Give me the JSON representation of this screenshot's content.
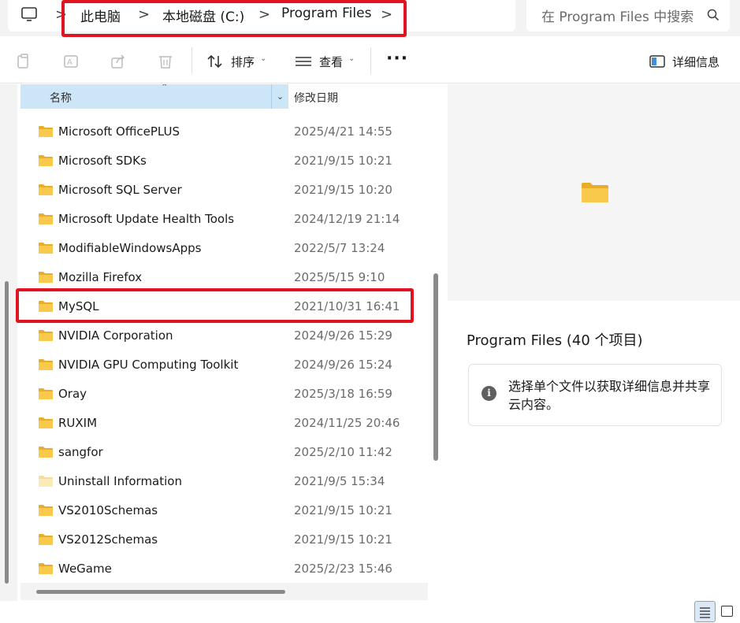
{
  "address_bar": {
    "breadcrumbs": [
      "此电脑",
      "本地磁盘 (C:)",
      "Program Files"
    ],
    "separator": ">",
    "search_placeholder": "在 Program Files 中搜索"
  },
  "toolbar": {
    "sort_label": "排序",
    "view_label": "查看",
    "more_label": "···",
    "details_label": "详细信息"
  },
  "file_list": {
    "columns": {
      "name": "名称",
      "modified": "修改日期"
    },
    "rows": [
      {
        "name": "Microsoft OfficePLUS",
        "modified": "2025/4/21 14:55"
      },
      {
        "name": "Microsoft SDKs",
        "modified": "2021/9/15 10:21"
      },
      {
        "name": "Microsoft SQL Server",
        "modified": "2021/9/15 10:20"
      },
      {
        "name": "Microsoft Update Health Tools",
        "modified": "2024/12/19 21:14"
      },
      {
        "name": "ModifiableWindowsApps",
        "modified": "2022/5/7 13:24"
      },
      {
        "name": "Mozilla Firefox",
        "modified": "2025/5/15 9:10"
      },
      {
        "name": "MySQL",
        "modified": "2021/10/31 16:41",
        "highlighted": true
      },
      {
        "name": "NVIDIA Corporation",
        "modified": "2024/9/26 15:29"
      },
      {
        "name": "NVIDIA GPU Computing Toolkit",
        "modified": "2024/9/26 15:24"
      },
      {
        "name": "Oray",
        "modified": "2025/3/18 16:59"
      },
      {
        "name": "RUXIM",
        "modified": "2024/11/25 20:46"
      },
      {
        "name": "sangfor",
        "modified": "2025/2/10 11:42"
      },
      {
        "name": "Uninstall Information",
        "modified": "2021/9/5 15:34",
        "faded": true
      },
      {
        "name": "VS2010Schemas",
        "modified": "2021/9/15 10:21"
      },
      {
        "name": "VS2012Schemas",
        "modified": "2021/9/15 10:21"
      },
      {
        "name": "WeGame",
        "modified": "2025/2/23 15:46"
      }
    ]
  },
  "details_pane": {
    "title": "Program Files (40 个项目)",
    "info_text": "选择单个文件以获取详细信息并共享云内容。"
  },
  "colors": {
    "highlight": "#e0141e",
    "header_bg": "#cce5f7",
    "folder": "#f8c94a"
  }
}
